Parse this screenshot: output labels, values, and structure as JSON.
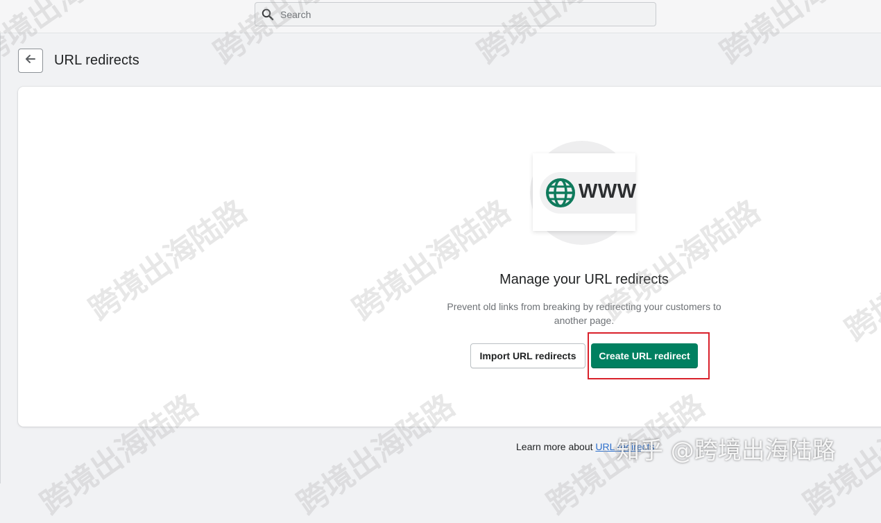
{
  "search": {
    "placeholder": "Search"
  },
  "header": {
    "back_icon": "arrow-left-icon",
    "title": "URL redirects"
  },
  "empty_state": {
    "illustration_text": "WWW",
    "illustration_icon": "globe-icon",
    "heading": "Manage your URL redirects",
    "description": "Prevent old links from breaking by redirecting your customers to another page.",
    "secondary_button": "Import URL redirects",
    "primary_button": "Create URL redirect"
  },
  "footer": {
    "text": "Learn more about ",
    "link_text": "URL redirects"
  },
  "watermark": {
    "text": "跨境出海陆路",
    "credit": "知乎 @跨境出海陆路"
  },
  "colors": {
    "primary": "#008060",
    "highlight": "#d9202a",
    "link": "#2c6ecb"
  }
}
